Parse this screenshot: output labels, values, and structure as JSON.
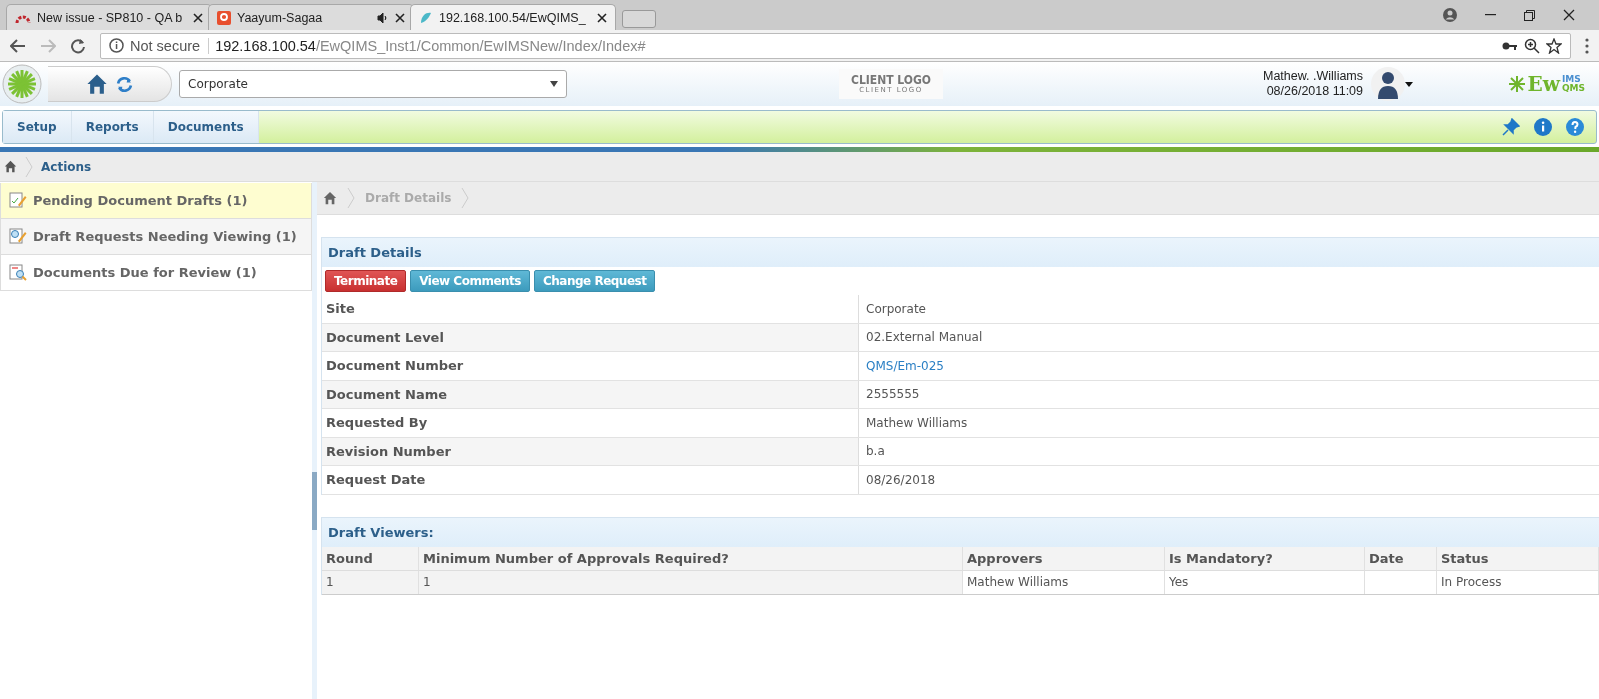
{
  "browser": {
    "tabs": [
      {
        "title": "New issue - SP810 - QA b",
        "kind": "issue",
        "audio": false,
        "selected": false
      },
      {
        "title": "Yaayum-Sagaa",
        "kind": "music",
        "audio": true,
        "selected": false
      },
      {
        "title": "192.168.100.54/EwQIMS_",
        "kind": "app",
        "audio": false,
        "selected": true
      }
    ],
    "address": {
      "security": "Not secure",
      "host": "192.168.100.54",
      "path": "/EwQIMS_Inst1/Common/EwIMSNew/Index/Index#"
    }
  },
  "header": {
    "site_select": {
      "value": "Corporate"
    },
    "client_logo": {
      "title": "CLIENT LOGO",
      "subtitle": "CLIENT LOGO"
    },
    "user": {
      "name": "Mathew. .Williams",
      "datetime": "08/26/2018 11:09"
    },
    "brand": {
      "text": "Ew",
      "sup": "IMS",
      "sub": "QMS"
    }
  },
  "menu": [
    {
      "label": "Setup"
    },
    {
      "label": "Reports"
    },
    {
      "label": "Documents"
    }
  ],
  "breadcrumb": [
    "Actions"
  ],
  "actions": [
    {
      "label": "Pending Document Drafts (1)",
      "kind": "edit",
      "selected": true
    },
    {
      "label": "Draft Requests Needing Viewing (1)",
      "kind": "view",
      "selected": false
    },
    {
      "label": "Documents Due for Review (1)",
      "kind": "review",
      "selected": false
    }
  ],
  "inner_breadcrumb": [
    "Draft Details"
  ],
  "draft_details": {
    "title": "Draft Details",
    "buttons": [
      {
        "label": "Terminate",
        "kind": "danger"
      },
      {
        "label": "View Comments",
        "kind": "info"
      },
      {
        "label": "Change Request",
        "kind": "info"
      }
    ],
    "fields": [
      {
        "label": "Site",
        "value": "Corporate",
        "kind": "text"
      },
      {
        "label": "Document Level",
        "value": "02.External Manual",
        "kind": "text"
      },
      {
        "label": "Document Number",
        "value": "QMS/Em-025",
        "kind": "link"
      },
      {
        "label": "Document Name",
        "value": "2555555",
        "kind": "text"
      },
      {
        "label": "Requested By",
        "value": "Mathew Williams",
        "kind": "text"
      },
      {
        "label": "Revision Number",
        "value": "b.a",
        "kind": "text"
      },
      {
        "label": "Request Date",
        "value": "08/26/2018",
        "kind": "text"
      }
    ]
  },
  "viewers": {
    "title": "Draft Viewers:",
    "columns": [
      "Round",
      "Minimum Number of Approvals Required?",
      "Approvers",
      "Is Mandatory?",
      "Date",
      "Status"
    ],
    "rows": [
      [
        "1",
        "1",
        "Mathew Williams",
        "Yes",
        "",
        "In Process"
      ]
    ]
  }
}
